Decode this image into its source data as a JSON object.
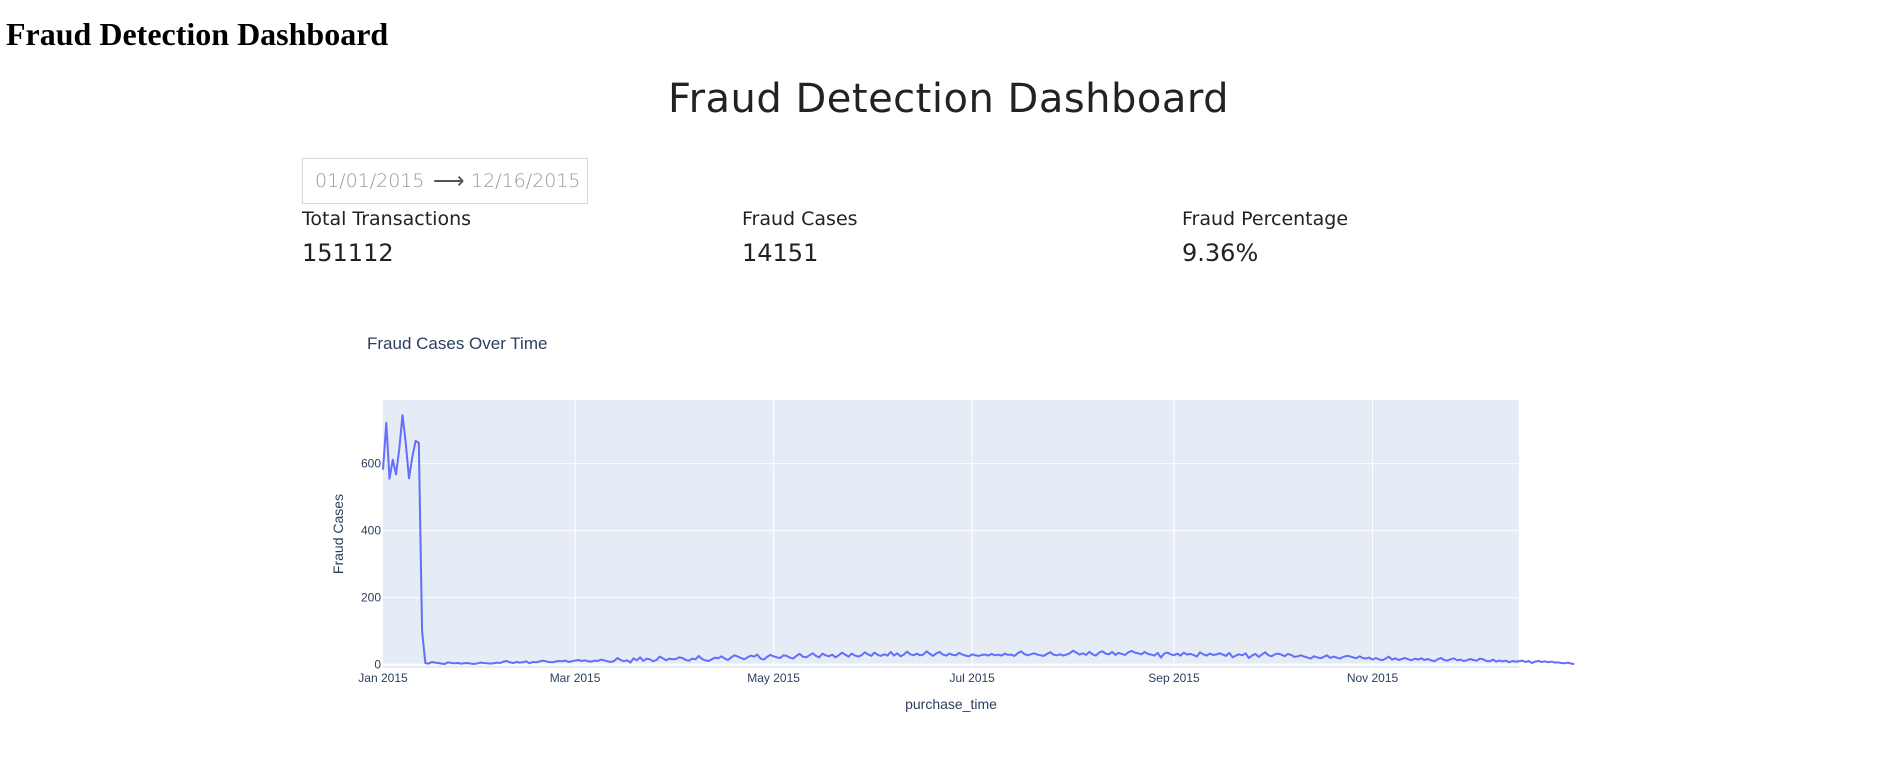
{
  "page": {
    "heading": "Fraud Detection Dashboard"
  },
  "dashboard": {
    "title": "Fraud Detection Dashboard",
    "date_range": {
      "start": "01/01/2015",
      "end": "12/16/2015",
      "arrow": "⟶"
    },
    "kpis": [
      {
        "label": "Total Transactions",
        "value": "151112"
      },
      {
        "label": "Fraud Cases",
        "value": "14151"
      },
      {
        "label": "Fraud Percentage",
        "value": "9.36%"
      }
    ]
  },
  "colors": {
    "line": "#636efa",
    "plot_bg": "#e5ecf6",
    "grid": "#ffffff",
    "text": "#2a3f5f"
  },
  "chart_data": {
    "type": "line",
    "title": "Fraud Cases Over Time",
    "xlabel": "purchase_time",
    "ylabel": "Fraud Cases",
    "x_start": "2015-01-01",
    "x_end": "2015-12-16",
    "xlim": [
      "2015-01-01",
      "2015-12-16"
    ],
    "ylim": [
      -10,
      790
    ],
    "grid": true,
    "x_ticks": [
      {
        "date": "2015-01-01",
        "label": "Jan 2015"
      },
      {
        "date": "2015-03-01",
        "label": "Mar 2015"
      },
      {
        "date": "2015-05-01",
        "label": "May 2015"
      },
      {
        "date": "2015-07-01",
        "label": "Jul 2015"
      },
      {
        "date": "2015-09-01",
        "label": "Sep 2015"
      },
      {
        "date": "2015-11-01",
        "label": "Nov 2015"
      }
    ],
    "y_ticks": [
      0,
      200,
      400,
      600
    ],
    "series": [
      {
        "values": [
          582,
          722,
          555,
          612,
          568,
          645,
          745,
          660,
          556,
          620,
          668,
          662,
          100,
          5,
          3,
          8,
          6,
          5,
          3,
          2,
          7,
          5,
          4,
          5,
          3,
          4,
          5,
          3,
          2,
          4,
          6,
          5,
          4,
          3,
          4,
          6,
          5,
          9,
          11,
          7,
          5,
          8,
          6,
          7,
          10,
          4,
          8,
          7,
          9,
          12,
          10,
          8,
          7,
          9,
          11,
          10,
          12,
          8,
          10,
          12,
          14,
          11,
          13,
          10,
          9,
          12,
          11,
          15,
          13,
          10,
          8,
          11,
          20,
          14,
          10,
          13,
          6,
          19,
          13,
          22,
          11,
          18,
          16,
          10,
          14,
          24,
          19,
          13,
          18,
          16,
          17,
          22,
          20,
          14,
          12,
          18,
          16,
          26,
          17,
          13,
          11,
          16,
          21,
          19,
          25,
          18,
          14,
          22,
          28,
          24,
          20,
          16,
          22,
          27,
          24,
          30,
          18,
          15,
          23,
          29,
          25,
          22,
          20,
          28,
          26,
          21,
          18,
          26,
          32,
          24,
          22,
          28,
          34,
          26,
          22,
          33,
          28,
          25,
          30,
          22,
          28,
          36,
          30,
          24,
          33,
          27,
          24,
          28,
          37,
          31,
          26,
          36,
          29,
          26,
          31,
          27,
          38,
          27,
          34,
          25,
          30,
          39,
          31,
          28,
          33,
          28,
          30,
          40,
          32,
          26,
          34,
          38,
          30,
          27,
          33,
          29,
          28,
          35,
          30,
          27,
          25,
          31,
          28,
          26,
          29,
          30,
          27,
          32,
          28,
          30,
          27,
          33,
          29,
          30,
          26,
          34,
          40,
          32,
          28,
          31,
          34,
          30,
          28,
          26,
          32,
          37,
          30,
          28,
          31,
          27,
          30,
          34,
          42,
          36,
          30,
          34,
          29,
          38,
          31,
          27,
          36,
          40,
          33,
          31,
          38,
          29,
          35,
          32,
          29,
          37,
          41,
          36,
          34,
          31,
          38,
          32,
          30,
          27,
          35,
          21,
          33,
          36,
          31,
          28,
          33,
          27,
          36,
          30,
          32,
          29,
          24,
          37,
          31,
          27,
          33,
          29,
          30,
          34,
          30,
          26,
          35,
          22,
          27,
          31,
          28,
          34,
          20,
          27,
          32,
          23,
          30,
          37,
          28,
          25,
          31,
          33,
          30,
          25,
          32,
          29,
          23,
          25,
          28,
          24,
          21,
          18,
          25,
          22,
          19,
          23,
          28,
          20,
          24,
          21,
          18,
          23,
          26,
          25,
          22,
          19,
          25,
          20,
          18,
          21,
          15,
          20,
          16,
          13,
          18,
          24,
          15,
          19,
          14,
          17,
          20,
          16,
          13,
          18,
          15,
          19,
          14,
          17,
          13,
          10,
          16,
          20,
          14,
          12,
          16,
          19,
          13,
          15,
          11,
          13,
          17,
          14,
          12,
          18,
          16,
          11,
          10,
          15,
          9,
          12,
          10,
          12,
          7,
          11,
          9,
          10,
          12,
          8,
          11,
          5,
          9,
          11,
          8,
          10,
          7,
          9,
          6,
          7,
          5,
          4,
          6,
          3,
          2
        ]
      }
    ]
  }
}
